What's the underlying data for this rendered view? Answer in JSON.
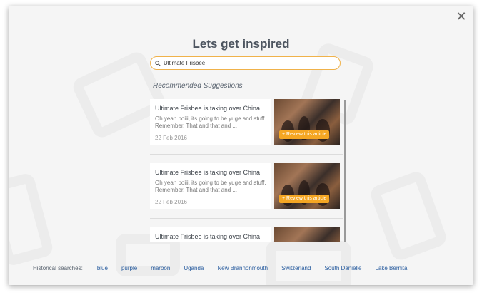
{
  "modal": {
    "title": "Lets get inspired",
    "close_icon": "close-icon"
  },
  "search": {
    "value": "Ultimate Frisbee",
    "icon": "search-icon",
    "accent_color": "#f0b24a"
  },
  "suggestions": {
    "heading": "Recommended Suggestions",
    "items": [
      {
        "title": "Ultimate Frisbee is taking over China",
        "excerpt": "Oh yeah boiii, its going to be yuge and stuff. Remember. That and that and ...",
        "date": "22 Feb 2016",
        "action": "+ Review this article"
      },
      {
        "title": "Ultimate Frisbee is taking over China",
        "excerpt": "Oh yeah boiii, its going to be yuge and stuff. Remember. That and that and ...",
        "date": "22 Feb 2016",
        "action": "+ Review this article"
      },
      {
        "title": "Ultimate Frisbee is taking over China",
        "excerpt": "",
        "date": "",
        "action": ""
      }
    ],
    "action_color": "#f5a623"
  },
  "history": {
    "label": "Historical searches:",
    "links": [
      "blue",
      "purple",
      "maroon",
      "Uganda",
      "New Brannonmouth",
      "Switzerland",
      "South Danielle",
      "Lake Bernita"
    ],
    "link_color": "#2a5d9f"
  }
}
